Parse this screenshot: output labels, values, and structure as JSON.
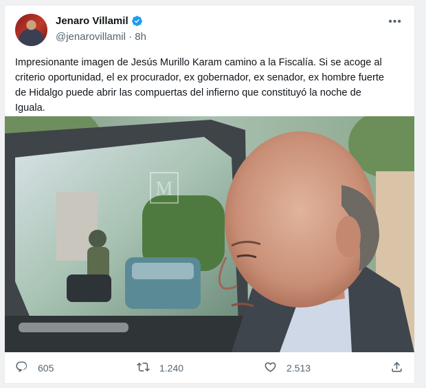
{
  "author": {
    "display_name": "Jenaro Villamil",
    "handle": "@jenarovillamil",
    "separator": "·",
    "time": "8h",
    "verified_icon": "verified-badge-icon",
    "verified_color": "#1d9bf0"
  },
  "tweet": {
    "lines": [
      "Impresionante imagen de Jesús Murillo Karam camino a la Fiscalía. Si se acoge al",
      "criterio oportunidad, el ex procurador, ex gobernador, ex senador, ex hombre fuerte",
      "de Hidalgo puede abrir las compuertas del infierno que constituyó la noche de",
      "Iguala."
    ]
  },
  "media": {
    "watermark": "M"
  },
  "actions": {
    "reply_count": "605",
    "retweet_count": "1.240",
    "like_count": "2.513",
    "reply_icon": "reply-icon",
    "retweet_icon": "retweet-icon",
    "like_icon": "heart-icon",
    "share_icon": "share-icon"
  },
  "colors": {
    "text": "#0f1419",
    "secondary": "#536471",
    "accent": "#1d9bf0"
  }
}
